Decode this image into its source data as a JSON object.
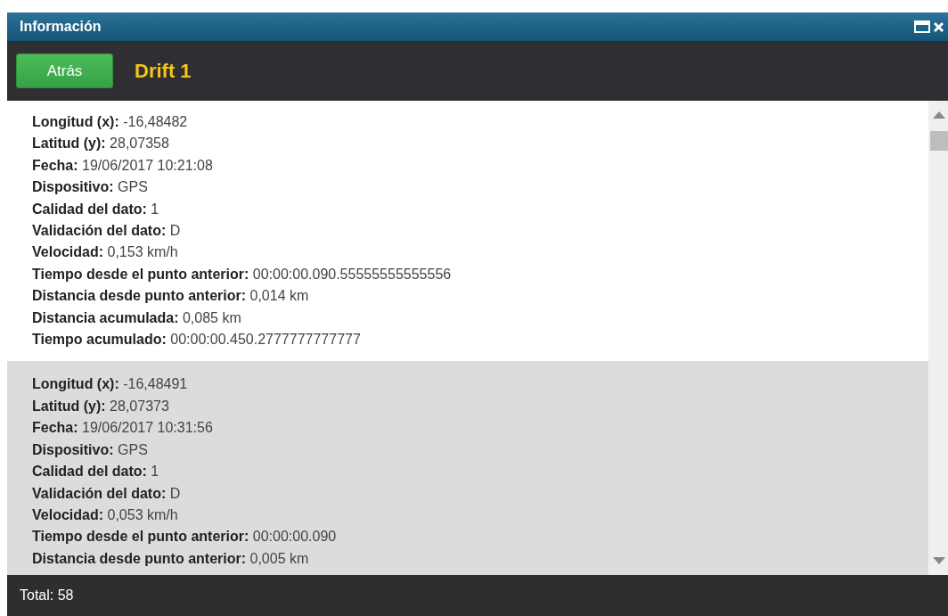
{
  "window": {
    "title": "Información"
  },
  "toolbar": {
    "back_button": "Atrás",
    "heading": "Drift 1"
  },
  "records": [
    {
      "fields": [
        {
          "label": "Longitud (x):",
          "value": "-16,48482"
        },
        {
          "label": "Latitud (y):",
          "value": "28,07358"
        },
        {
          "label": "Fecha:",
          "value": "19/06/2017 10:21:08"
        },
        {
          "label": "Dispositivo:",
          "value": "GPS"
        },
        {
          "label": "Calidad del dato:",
          "value": "1"
        },
        {
          "label": "Validación del dato:",
          "value": "D"
        },
        {
          "label": "Velocidad:",
          "value": "0,153 km/h"
        },
        {
          "label": "Tiempo desde el punto anterior:",
          "value": "00:00:00.090.55555555555556"
        },
        {
          "label": "Distancia desde punto anterior:",
          "value": "0,014 km"
        },
        {
          "label": "Distancia acumulada:",
          "value": "0,085 km"
        },
        {
          "label": "Tiempo acumulado:",
          "value": "00:00:00.450.2777777777777"
        }
      ]
    },
    {
      "fields": [
        {
          "label": "Longitud (x):",
          "value": "-16,48491"
        },
        {
          "label": "Latitud (y):",
          "value": "28,07373"
        },
        {
          "label": "Fecha:",
          "value": "19/06/2017 10:31:56"
        },
        {
          "label": "Dispositivo:",
          "value": "GPS"
        },
        {
          "label": "Calidad del dato:",
          "value": "1"
        },
        {
          "label": "Validación del dato:",
          "value": "D"
        },
        {
          "label": "Velocidad:",
          "value": "0,053 km/h"
        },
        {
          "label": "Tiempo desde el punto anterior:",
          "value": "00:00:00.090"
        },
        {
          "label": "Distancia desde punto anterior:",
          "value": "0,005 km"
        }
      ]
    }
  ],
  "status_bar": {
    "total": "Total: 58"
  }
}
